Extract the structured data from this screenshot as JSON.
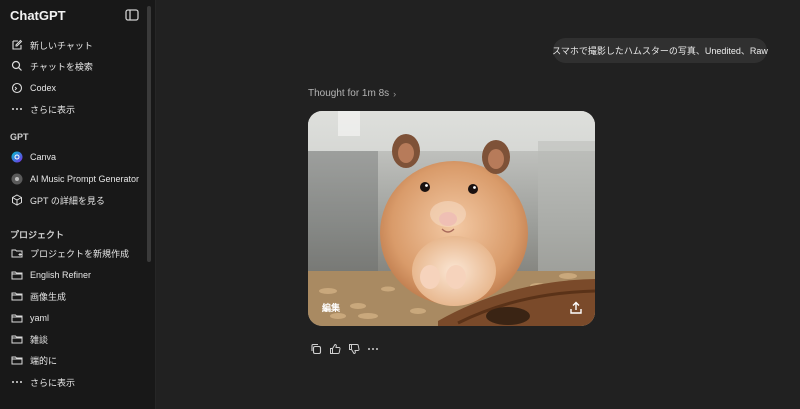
{
  "sidebar": {
    "brand": "ChatGPT",
    "primary_items": [
      {
        "label": "新しいチャット",
        "icon": "new-chat-icon"
      },
      {
        "label": "チャットを検索",
        "icon": "search-icon"
      },
      {
        "label": "Codex",
        "icon": "codex-icon"
      },
      {
        "label": "さらに表示",
        "icon": "more-icon"
      }
    ],
    "gpt_heading": "GPT",
    "gpt_items": [
      {
        "label": "Canva",
        "icon": "canva-icon"
      },
      {
        "label": "AI Music Prompt Generator",
        "icon": "ai-music-icon"
      },
      {
        "label": "GPT の詳細を見る",
        "icon": "cube-icon"
      }
    ],
    "projects_heading": "プロジェクト",
    "project_items": [
      {
        "label": "プロジェクトを新規作成",
        "icon": "new-folder-icon"
      },
      {
        "label": "English Refiner",
        "icon": "folder-icon"
      },
      {
        "label": "画像生成",
        "icon": "folder-icon"
      },
      {
        "label": "yaml",
        "icon": "folder-icon"
      },
      {
        "label": "雑談",
        "icon": "folder-icon"
      },
      {
        "label": "端的に",
        "icon": "folder-icon"
      },
      {
        "label": "さらに表示",
        "icon": "more-icon"
      }
    ]
  },
  "chat": {
    "user_message": "スマホで撮影したハムスターの写真、Unedited、Raw",
    "thought_label": "Thought for 1m 8s",
    "image": {
      "subject": "hamster-photo",
      "edit_label": "編集"
    }
  },
  "colors": {
    "background": "#212121",
    "sidebar": "#181818",
    "bubble": "#303030"
  }
}
